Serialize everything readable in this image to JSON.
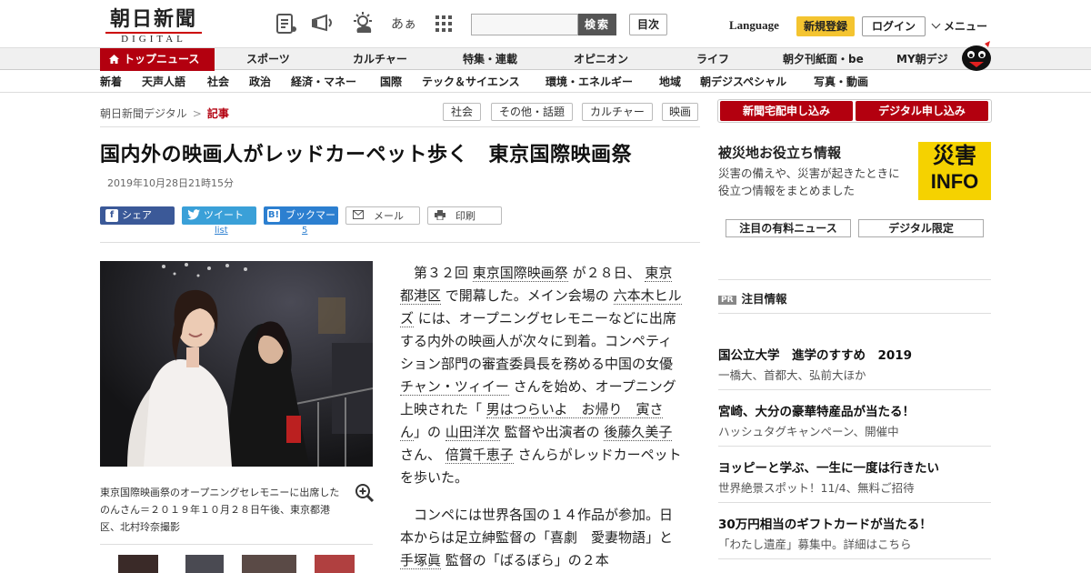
{
  "header": {
    "logo_kanji": "朝日新聞",
    "logo_digital": "DIGITAL",
    "icons": [
      "news-paper-icon",
      "megaphone-icon",
      "weather-icon",
      "font-size-icon",
      "grid-menu-icon"
    ],
    "font_size_glyph": "あぁ",
    "search_placeholder": "",
    "search_button": "検索",
    "contents_button": "目次",
    "language": "Language",
    "register": "新規登録",
    "login": "ログイン",
    "menu": "メニュー"
  },
  "nav_main": [
    {
      "label": "トップニュース",
      "active": true
    },
    {
      "label": "スポーツ"
    },
    {
      "label": "カルチャー"
    },
    {
      "label": "特集・連載"
    },
    {
      "label": "オピニオン"
    },
    {
      "label": "ライフ"
    },
    {
      "label": "朝夕刊紙面・be"
    },
    {
      "label": "MY朝デジ"
    }
  ],
  "nav_sub": [
    "新着",
    "天声人語",
    "社会",
    "政治",
    "経済・マネー",
    "国際",
    "テック＆サイエンス",
    "環境・エネルギー",
    "地域",
    "朝デジスペシャル",
    "写真・動画"
  ],
  "breadcrumb": {
    "home": "朝日新聞デジタル",
    "separator": ">",
    "current": "記事"
  },
  "tags": [
    "社会",
    "その他・話題",
    "カルチャー",
    "映画"
  ],
  "article": {
    "title": "国内外の映画人がレッドカーペット歩く　東京国際映画祭",
    "date": "2019年10月28日21時15分",
    "share": {
      "facebook": "シェア",
      "twitter": "ツイート",
      "twitter_count": "list",
      "hatena": "ブックマーク",
      "hatena_count": "5",
      "mail": "メール",
      "print": "印刷"
    },
    "photo_caption": "東京国際映画祭のオープニングセレモニーに出席したのんさん＝２０１９年１０月２８日午後、東京都港区、北村玲奈撮影",
    "p1": [
      {
        "t": "第３２回 "
      },
      {
        "t": "東京国際映画祭",
        "link": true
      },
      {
        "t": " が２８日、 "
      },
      {
        "t": "東京都港区",
        "link": true
      },
      {
        "t": " で開幕した。メイン会場の "
      },
      {
        "t": "六本木ヒルズ",
        "link": true
      },
      {
        "t": " には、オープニングセレモニーなどに出席する内外の映画人が次々に到着。コンペティション部門の審査委員長を務める中国の女優 "
      },
      {
        "t": "チャン・ツィイー",
        "link": true
      },
      {
        "t": " さんを始め、オープニング上映された「 "
      },
      {
        "t": "男はつらいよ　お帰り　寅さん",
        "link": true
      },
      {
        "t": "」の "
      },
      {
        "t": "山田洋次",
        "link": true
      },
      {
        "t": " 監督や出演者の "
      },
      {
        "t": "後藤久美子",
        "link": true
      },
      {
        "t": " さん、 "
      },
      {
        "t": "倍賞千恵子",
        "link": true
      },
      {
        "t": " さんらがレッドカーペットを歩いた。"
      }
    ],
    "p2": [
      {
        "t": "コンペには世界各国の１４作品が参加。日本からは足立紳監督の「喜劇　愛妻物語」と "
      },
      {
        "t": "手塚眞",
        "link": true
      },
      {
        "t": " 監督の「ばるぼら」の２本"
      }
    ]
  },
  "sidebar": {
    "buttons": [
      "新聞宅配申し込み",
      "デジタル申し込み"
    ],
    "disaster_title": "被災地お役立ち情報",
    "disaster_text": "災害の備えや、災害が起きたときに役立つ情報をまとめました",
    "disaster_banner_top": "災害",
    "disaster_banner_bottom": "INFO",
    "tabs": [
      "注目の有料ニュース",
      "デジタル限定"
    ],
    "pr_badge": "PR",
    "pr_title": "注目情報",
    "ads": [
      {
        "h": "国公立大学　進学のすすめ　2019",
        "s": "一橋大、首都大、弘前大ほか"
      },
      {
        "h": "宮崎、大分の豪華特産品が当たる！",
        "s": "ハッシュタグキャンペーン、開催中"
      },
      {
        "h": "ヨッピーと学ぶ、一生に一度は行きたい",
        "s": "世界絶景スポット！11/4、無料ご招待"
      },
      {
        "h": "30万円相当のギフトカードが当たる！",
        "s": "「わたし遺産」募集中。詳細はこちら"
      }
    ]
  },
  "colors": {
    "brand_red": "#b3000f",
    "register_yellow": "#f4c430",
    "facebook": "#3b5998",
    "twitter": "#3aa0d8",
    "hatena": "#2c7fd0",
    "disaster_yellow": "#f5d200"
  }
}
